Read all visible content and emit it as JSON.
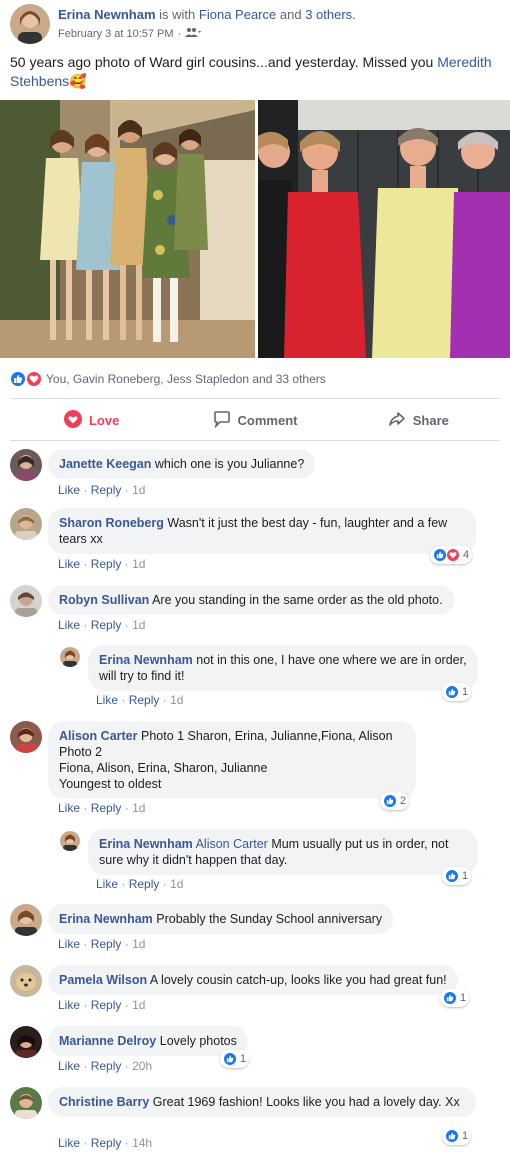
{
  "post": {
    "author": "Erina Newnham",
    "with_text": "is with",
    "tagged_person": "Fiona Pearce",
    "and_text": "and",
    "others": "3 others.",
    "timestamp": "February 3 at 10:57 PM",
    "privacy_icon": "friends-icon",
    "text": "50 years ago photo of Ward girl cousins...and yesterday. Missed you ",
    "mention": "Meredith Stehbens",
    "emoji": "🥰"
  },
  "reactions": {
    "summary": "You, Gavin Roneberg, Jess Stapledon and 33 others",
    "icons": [
      "like-icon",
      "love-icon"
    ]
  },
  "actions": {
    "love": "Love",
    "comment": "Comment",
    "share": "Share"
  },
  "comment_actions": {
    "like": "Like",
    "reply": "Reply"
  },
  "comments": [
    {
      "name": "Janette Keegan",
      "text": "which one is you Julianne?",
      "time": "1d"
    },
    {
      "name": "Sharon Roneberg",
      "text": "Wasn't it just the best day - fun, laughter and a few tears xx",
      "time": "1d",
      "reaction_count": "4"
    },
    {
      "name": "Robyn Sullivan",
      "text": "Are you standing in the same order as the old photo.",
      "time": "1d"
    },
    {
      "name": "Erina Newnham",
      "text": "not in this one, I have one where we are in order, will try to find it!",
      "time": "1d",
      "reaction_count": "1"
    },
    {
      "name": "Alison Carter",
      "text_lines": [
        "Photo 1 Sharon, Erina, Julianne,Fiona, Alison",
        "Photo 2",
        "Fiona, Alison, Erina, Sharon, Julianne",
        "Youngest to oldest"
      ],
      "time": "1d",
      "reaction_count": "2"
    },
    {
      "name": "Erina Newnham",
      "mention": "Alison Carter",
      "text": "Mum usually put us in order, not sure why it didn't happen that day.",
      "time": "1d",
      "reaction_count": "1"
    },
    {
      "name": "Erina Newnham",
      "text": "Probably the Sunday School anniversary",
      "time": "1d"
    },
    {
      "name": "Pamela Wilson",
      "text": "A lovely cousin catch-up, looks like you had great fun!",
      "time": "1d",
      "reaction_count": "1"
    },
    {
      "name": "Marianne Delroy",
      "text": "Lovely photos",
      "time": "20h",
      "reaction_count": "1"
    },
    {
      "name": "Christine Barry",
      "text": "Great 1969 fashion! Looks like you had a lovely day. Xx",
      "time": "14h",
      "reaction_count": "1"
    }
  ],
  "colors": {
    "link": "#385898",
    "like_blue": "#1877f2",
    "love_red": "#f33e58",
    "bubble_bg": "#f2f3f5",
    "muted": "#90949c"
  }
}
